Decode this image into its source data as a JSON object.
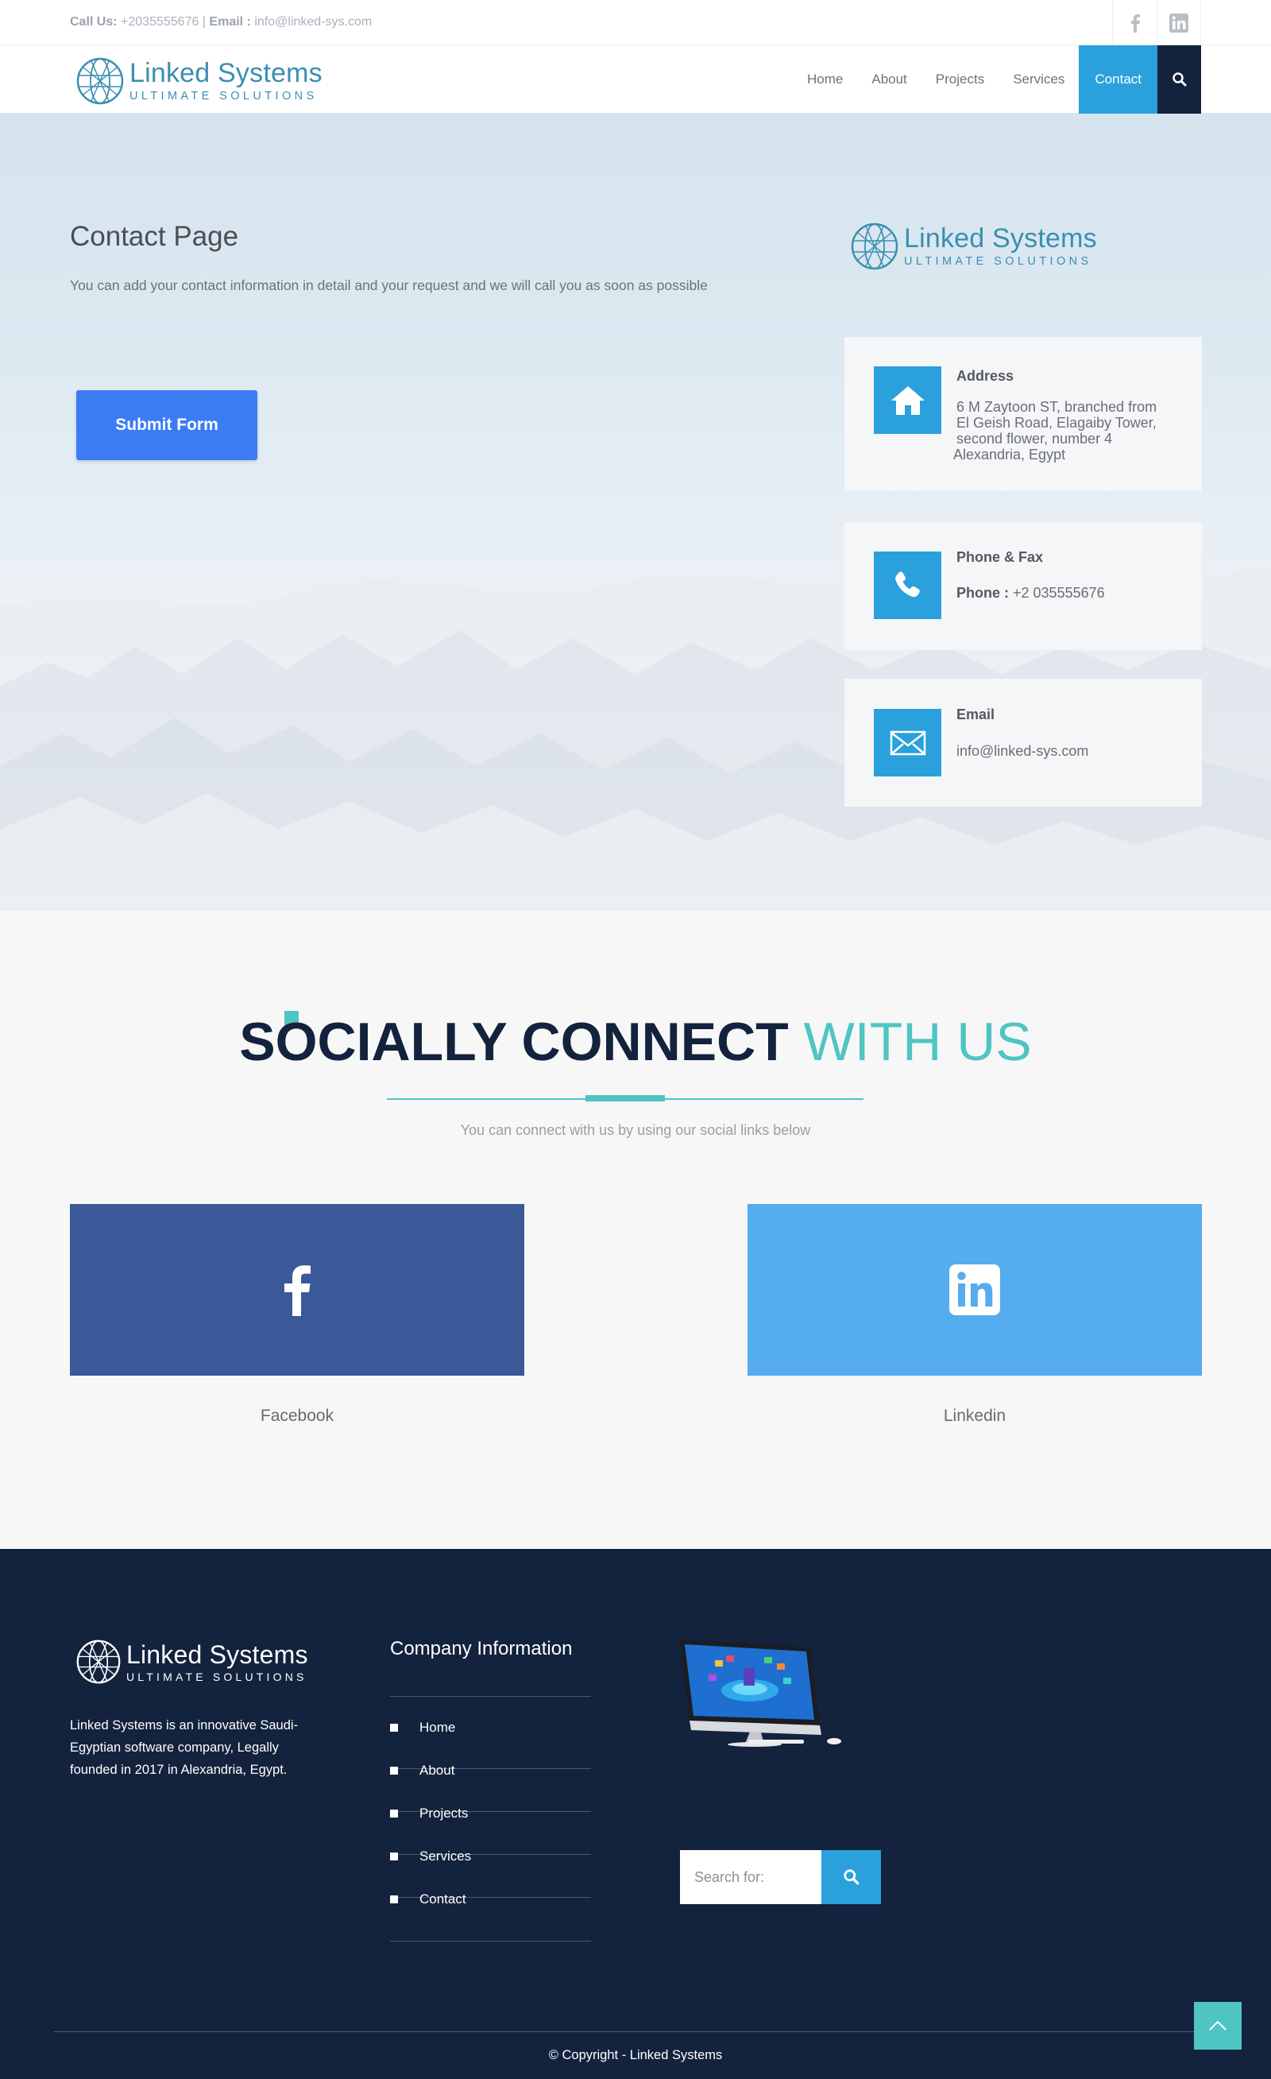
{
  "topbar": {
    "call_label": "Call Us:",
    "call_value": "+2035555676",
    "separator": "|",
    "email_label": "Email :",
    "email_value": "info@linked-sys.com",
    "social_icons": [
      "facebook-icon",
      "linkedin-icon"
    ]
  },
  "logo": {
    "name": "Linked Systems",
    "tagline": "ULTIMATE SOLUTIONS"
  },
  "nav": {
    "items": [
      "Home",
      "About",
      "Projects",
      "Services",
      "Contact"
    ],
    "active": "Contact"
  },
  "hero": {
    "title": "Contact Page",
    "description": "You can add your contact information in detail and your request and we will call you as soon as possible",
    "submit_label": "Submit Form"
  },
  "contact_cards": {
    "address": {
      "title": "Address",
      "lines": [
        "6 M Zaytoon ST, branched from",
        "El Geish Road, Elagaiby Tower,",
        "second flower, number 4",
        "Alexandria, Egypt"
      ]
    },
    "phone": {
      "title": "Phone & Fax",
      "label": "Phone :",
      "value": "+2 035555676"
    },
    "email": {
      "title": "Email",
      "value": "info@linked-sys.com"
    }
  },
  "social": {
    "heading_bold": "SOCIALLY CONNECT",
    "heading_light": "WITH US",
    "subtitle": "You can connect with us by using our social links below",
    "facebook_label": "Facebook",
    "linkedin_label": "Linkedin",
    "facebook_color": "#3b5998",
    "linkedin_color": "#55acee"
  },
  "footer": {
    "about": "Linked Systems is an innovative Saudi-Egyptian software company, Legally founded in 2017 in Alexandria, Egypt.",
    "company_info_title": "Company Information",
    "links": [
      "Home",
      "About",
      "Projects",
      "Services",
      "Contact"
    ],
    "search_placeholder": "Search for:",
    "copyright": "© Copyright - Linked Systems"
  },
  "colors": {
    "accent_blue": "#2aa1dc",
    "navy": "#13223d",
    "teal": "#4fc5c3",
    "submit_blue": "#3b7cf5"
  }
}
